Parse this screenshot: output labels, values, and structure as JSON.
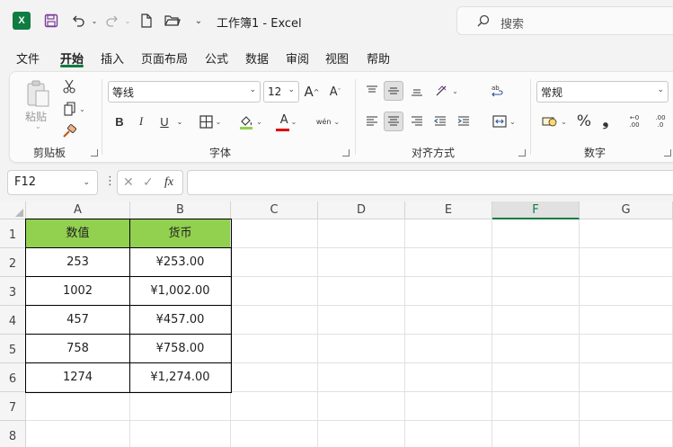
{
  "titlebar": {
    "app_icon": "X",
    "title": "工作簿1  -  Excel",
    "search_placeholder": "搜索"
  },
  "menu": {
    "items": [
      "文件",
      "开始",
      "插入",
      "页面布局",
      "公式",
      "数据",
      "审阅",
      "视图",
      "帮助"
    ],
    "active": "开始"
  },
  "ribbon": {
    "clipboard": {
      "label": "剪贴板",
      "paste_label": "粘贴"
    },
    "font": {
      "label": "字体",
      "font_name": "等线",
      "font_size": "12",
      "bold": "B",
      "italic": "I",
      "underline": "U",
      "font_color_glyph": "A",
      "phonetic": "wén"
    },
    "alignment": {
      "label": "对齐方式"
    },
    "number": {
      "label": "数字",
      "format": "常规",
      "percent": "%",
      "comma": "❟",
      "inc_decimal": ".00",
      "dec_decimal": ".0"
    }
  },
  "formula_bar": {
    "name_box": "F12",
    "fx": "fx",
    "value": ""
  },
  "grid": {
    "columns": [
      "A",
      "B",
      "C",
      "D",
      "E",
      "F",
      "G"
    ],
    "selected_column": "F",
    "rows": [
      "1",
      "2",
      "3",
      "4",
      "5",
      "6",
      "7",
      "8"
    ],
    "table": {
      "headers": [
        "数值",
        "货币"
      ],
      "rows": [
        [
          "253",
          "¥253.00"
        ],
        [
          "1002",
          "¥1,002.00"
        ],
        [
          "457",
          "¥457.00"
        ],
        [
          "758",
          "¥758.00"
        ],
        [
          "1274",
          "¥1,274.00"
        ]
      ],
      "header_fill": "#92d050"
    }
  },
  "colors": {
    "accent": "#107c41"
  }
}
